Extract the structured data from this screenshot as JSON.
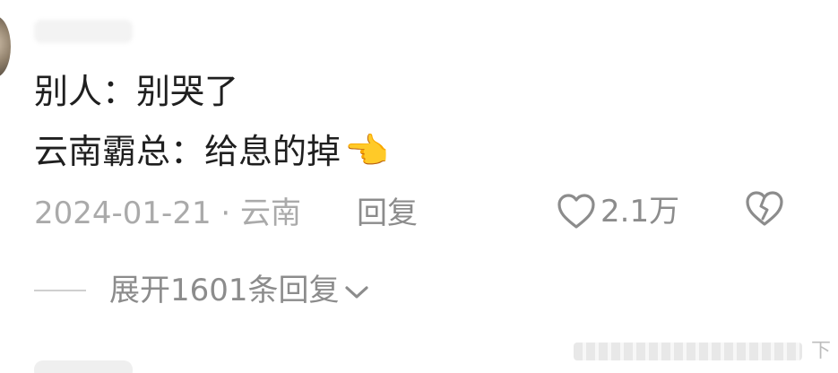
{
  "comment": {
    "line1": "别人：别哭了",
    "line2": "云南霸总：给息的掉",
    "emoji": "👈",
    "meta": "2024-01-21 · 云南",
    "reply_label": "回复",
    "like_count": "2.1万",
    "expand_label": "展开1601条回复"
  },
  "icons": {
    "like": "heart-icon",
    "dislike": "broken-heart-icon",
    "expand": "chevron-down-icon"
  },
  "watermark": {
    "corner_text": "下"
  },
  "colors": {
    "text_primary": "#1f1f1f",
    "text_secondary": "#8c8c8c",
    "text_meta": "#aaaaaa"
  }
}
